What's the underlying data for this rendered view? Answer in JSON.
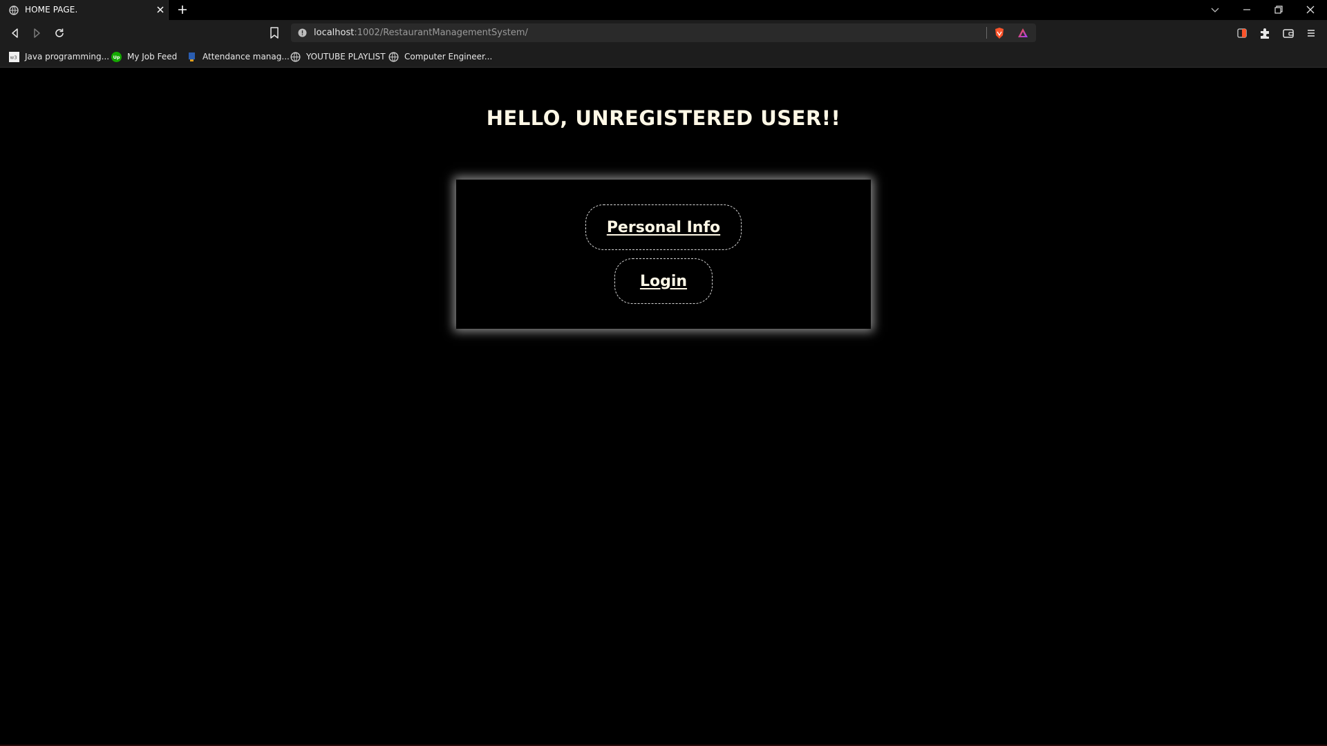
{
  "browser": {
    "tab": {
      "title": "HOME PAGE.",
      "favicon": "globe-icon"
    },
    "url": {
      "host": "localhost",
      "rest": ":1002/RestaurantManagementSystem/"
    },
    "bookmarks": [
      {
        "label": "Java programming...",
        "icon": "w3schools-icon"
      },
      {
        "label": "My Job Feed",
        "icon": "upwork-icon"
      },
      {
        "label": "Attendance manag...",
        "icon": "attendance-icon"
      },
      {
        "label": "YOUTUBE PLAYLIST",
        "icon": "globe-icon"
      },
      {
        "label": "Computer Engineer...",
        "icon": "globe-icon"
      }
    ],
    "colors": {
      "chrome": "#1d1d1d",
      "tabstrip": "#000000",
      "urlbar": "#2a2a2a",
      "brave_orange": "#fb542b"
    }
  },
  "page": {
    "heading": "HELLO, UNREGISTERED USER!!",
    "buttons": {
      "personal_info": "Personal Info",
      "login": "Login"
    },
    "colors": {
      "background": "#000000",
      "text": "#fff8e6",
      "card_glow": "#ffffff"
    }
  }
}
